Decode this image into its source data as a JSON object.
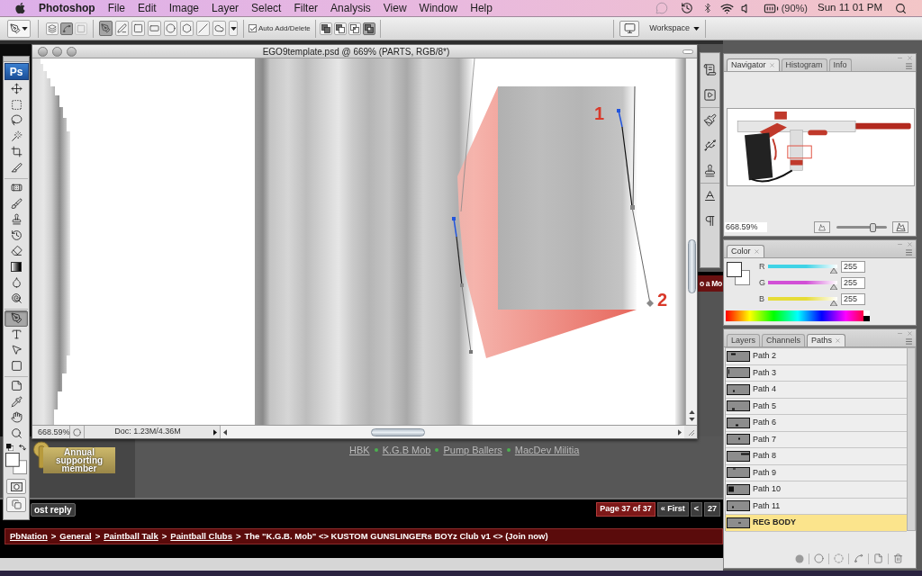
{
  "menu_bar": {
    "app_name": "Photoshop",
    "menus": [
      "File",
      "Edit",
      "Image",
      "Layer",
      "Select",
      "Filter",
      "Analysis",
      "View",
      "Window",
      "Help"
    ],
    "battery": "(90%)",
    "clock": "Sun 11 01 PM"
  },
  "options_bar": {
    "mode_buttons": [
      {
        "kind": "shape-layers",
        "selected": false,
        "disabled": false
      },
      {
        "kind": "paths",
        "selected": true,
        "disabled": false
      },
      {
        "kind": "fill-pixels",
        "selected": false,
        "disabled": true
      }
    ],
    "shape_tools": [
      {
        "kind": "pen",
        "selected": true
      },
      {
        "kind": "freeform-pen",
        "selected": false
      },
      {
        "kind": "rectangle",
        "selected": false
      },
      {
        "kind": "rounded-rectangle",
        "selected": false
      },
      {
        "kind": "ellipse",
        "selected": false
      },
      {
        "kind": "polygon",
        "selected": false
      },
      {
        "kind": "line",
        "selected": false
      },
      {
        "kind": "custom-shape",
        "selected": false
      }
    ],
    "auto_add_delete": {
      "label": "Auto Add/Delete",
      "checked": true
    },
    "path_operations": [
      {
        "kind": "add",
        "selected": false
      },
      {
        "kind": "subtract",
        "selected": false
      },
      {
        "kind": "intersect",
        "selected": false
      },
      {
        "kind": "exclude",
        "selected": true
      }
    ],
    "workspace": {
      "label": "Workspace"
    }
  },
  "toolbox": {
    "logo": "Ps",
    "tool_groups": [
      [
        {
          "kind": "move",
          "selected": false
        },
        {
          "kind": "marquee",
          "selected": false
        },
        {
          "kind": "lasso",
          "selected": false
        },
        {
          "kind": "magic-wand",
          "selected": false
        },
        {
          "kind": "crop",
          "selected": false
        },
        {
          "kind": "slice",
          "selected": false
        }
      ],
      [
        {
          "kind": "healing",
          "selected": false
        },
        {
          "kind": "brush",
          "selected": false
        },
        {
          "kind": "stamp",
          "selected": false
        },
        {
          "kind": "history-brush",
          "selected": false
        },
        {
          "kind": "eraser",
          "selected": false
        },
        {
          "kind": "gradient",
          "selected": false
        },
        {
          "kind": "blur",
          "selected": false
        },
        {
          "kind": "dodge",
          "selected": false
        }
      ],
      [
        {
          "kind": "pen",
          "selected": true
        },
        {
          "kind": "type",
          "selected": false
        },
        {
          "kind": "path-select",
          "selected": false
        },
        {
          "kind": "shape",
          "selected": false
        }
      ],
      [
        {
          "kind": "notes",
          "selected": false
        },
        {
          "kind": "eyedropper",
          "selected": false
        },
        {
          "kind": "hand",
          "selected": false
        },
        {
          "kind": "zoom",
          "selected": false
        }
      ]
    ]
  },
  "document": {
    "title": "EGO9template.psd @ 669% (PARTS, RGB/8*)",
    "callout_numbers": [
      "1",
      "2"
    ],
    "zoom": "668.59%",
    "doc_size": "Doc: 1.23M/4.36M"
  },
  "navigator": {
    "tabs": [
      {
        "label": "Navigator",
        "selected": true
      },
      {
        "label": "Histogram",
        "selected": false
      },
      {
        "label": "Info",
        "selected": false
      }
    ],
    "zoom": "668.59%",
    "level": 0.75
  },
  "color_panel": {
    "tabs": [
      {
        "label": "Color",
        "selected": true
      }
    ],
    "channels": [
      {
        "name": "R",
        "value": "255",
        "level": 1,
        "color": "#3fd3e6"
      },
      {
        "name": "G",
        "value": "255",
        "level": 1,
        "color": "#d24fd6"
      },
      {
        "name": "B",
        "value": "255",
        "level": 1,
        "color": "#e6dc36"
      }
    ]
  },
  "paths_panel": {
    "tabs": [
      {
        "label": "Layers",
        "selected": false
      },
      {
        "label": "Channels",
        "selected": false
      },
      {
        "label": "Paths",
        "selected": true
      }
    ],
    "paths": [
      {
        "name": "Path 2",
        "selected": false
      },
      {
        "name": "Path 3",
        "selected": false
      },
      {
        "name": "Path 4",
        "selected": false
      },
      {
        "name": "Path 5",
        "selected": false
      },
      {
        "name": "Path 6",
        "selected": false
      },
      {
        "name": "Path 7",
        "selected": false
      },
      {
        "name": "Path 8",
        "selected": false
      },
      {
        "name": "Path 9",
        "selected": false
      },
      {
        "name": "Path 10",
        "selected": false
      },
      {
        "name": "Path 11",
        "selected": false
      },
      {
        "name": "REG BODY",
        "selected": true
      }
    ]
  },
  "web_page": {
    "side_link": "o a Mo",
    "badge_text": "Annual supporting member",
    "club_links": [
      "HBK",
      "K.G.B Mob",
      "Pump Ballers",
      "MacDev Militia"
    ],
    "post_reply": "ost reply",
    "pagination": [
      {
        "kind": "status",
        "label": "Page 37 of 37"
      },
      {
        "kind": "link",
        "label": "« First"
      },
      {
        "kind": "link",
        "label": "<"
      },
      {
        "kind": "link",
        "label": "27"
      }
    ],
    "breadcrumb": [
      {
        "kind": "link",
        "text": "PbNation"
      },
      {
        "kind": "separator",
        "text": ">"
      },
      {
        "kind": "link",
        "text": "General"
      },
      {
        "kind": "separator",
        "text": ">"
      },
      {
        "kind": "link",
        "text": "Paintball Talk"
      },
      {
        "kind": "separator",
        "text": ">"
      },
      {
        "kind": "link",
        "text": "Paintball Clubs"
      },
      {
        "kind": "separator",
        "text": ">"
      },
      {
        "kind": "text",
        "text": "The \"K.G.B. Mob\" <> KUSTOM GUNSLINGERs BOYz Club v1 <> (Join now)"
      }
    ]
  }
}
